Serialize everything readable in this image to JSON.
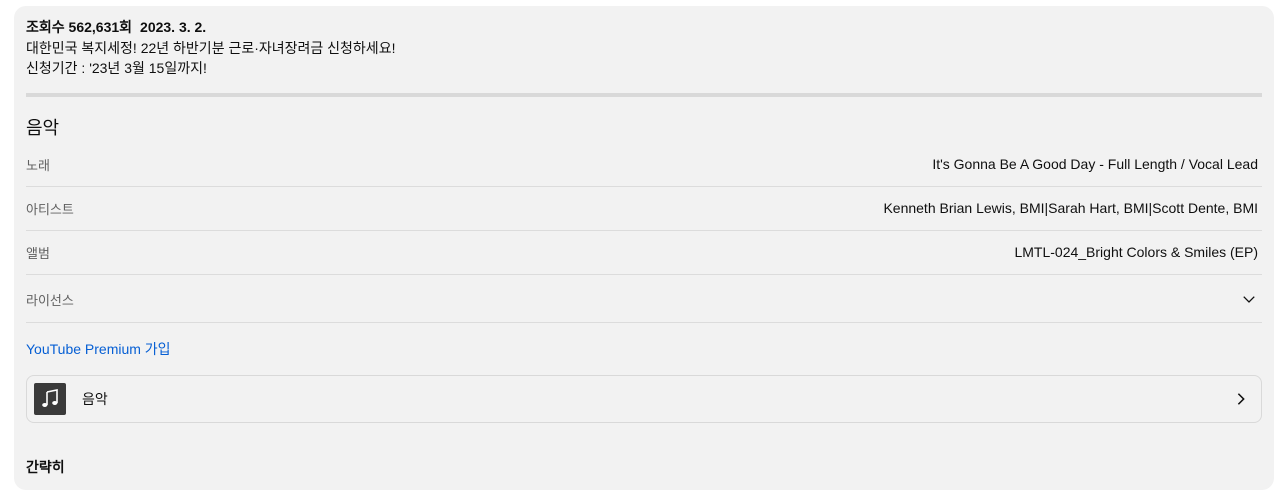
{
  "description": {
    "views": "조회수 562,631회",
    "date": "2023. 3. 2.",
    "line1": "대한민국 복지세정! 22년 하반기분 근로·자녀장려금 신청하세요!",
    "line2": "신청기간 : '23년 3월 15일까지!"
  },
  "music": {
    "section_title": "음악",
    "rows": [
      {
        "label": "노래",
        "value": "It's Gonna Be A Good Day - Full Length / Vocal Lead"
      },
      {
        "label": "아티스트",
        "value": "Kenneth Brian Lewis, BMI|Sarah Hart, BMI|Scott Dente, BMI"
      },
      {
        "label": "앨범",
        "value": "LMTL-024_Bright Colors & Smiles (EP)"
      },
      {
        "label": "라이선스",
        "value": ""
      }
    ],
    "premium_link": "YouTube Premium 가입",
    "card_label": "음악",
    "card_icon": "music-note-icon"
  },
  "summary_label": "간략히",
  "colors": {
    "panel_bg": "#f2f2f2",
    "link": "#065fd4",
    "divider": "#dcdcdc"
  }
}
